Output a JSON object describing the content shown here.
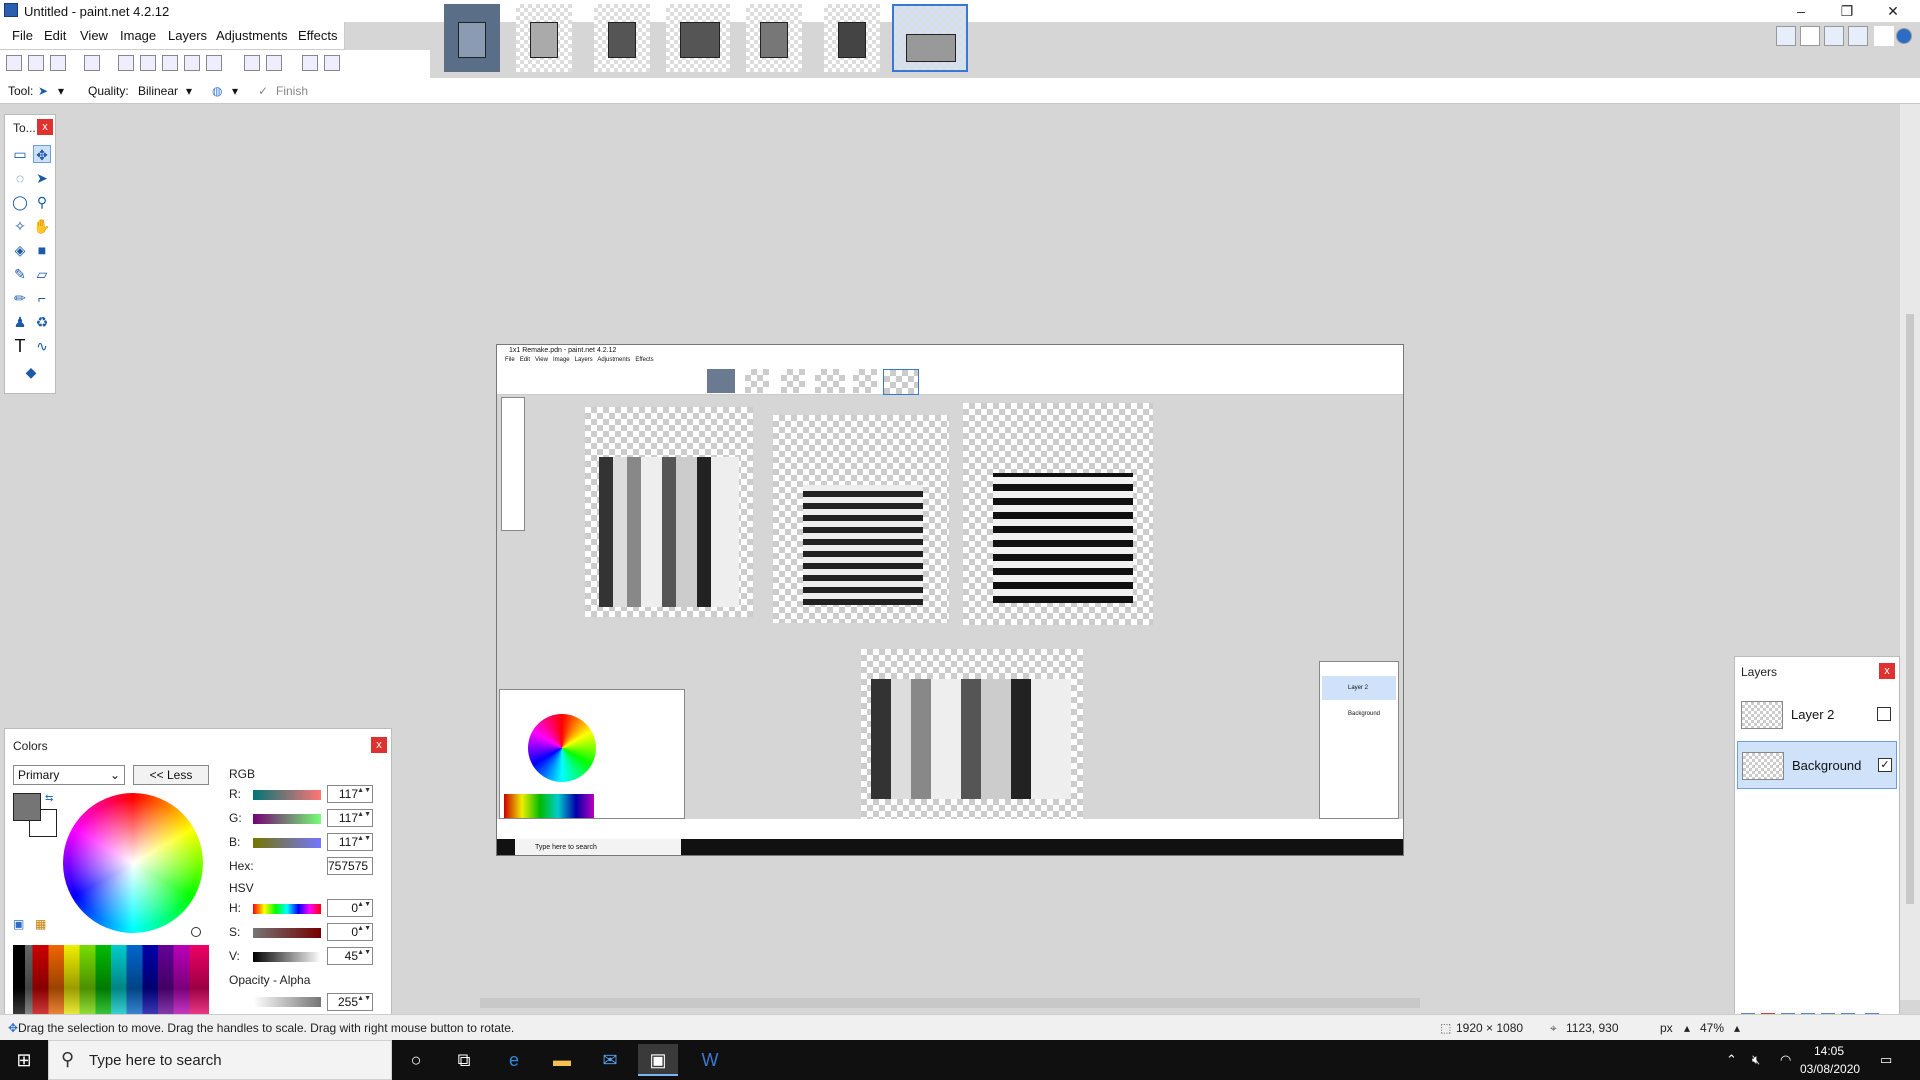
{
  "window": {
    "title": "Untitled - paint.net 4.2.12",
    "controls": [
      "–",
      "❐",
      "✕"
    ]
  },
  "menu": [
    "File",
    "Edit",
    "View",
    "Image",
    "Layers",
    "Adjustments",
    "Effects"
  ],
  "toolbar": {
    "tool_label": "Tool:",
    "quality_label": "Quality:",
    "quality_value": "Bilinear",
    "finish_label": "Finish",
    "finish_check": "✓",
    "dropdown_caret": "▾"
  },
  "tools_panel": {
    "title": "To...",
    "close": "x",
    "tools": [
      {
        "name": "rectangle-select",
        "glyph": "▭"
      },
      {
        "name": "move-selection",
        "glyph": "✥"
      },
      {
        "name": "lasso-select",
        "glyph": "◌"
      },
      {
        "name": "move-selected",
        "glyph": "➤"
      },
      {
        "name": "ellipse-select",
        "glyph": "◯"
      },
      {
        "name": "zoom",
        "glyph": "⚲"
      },
      {
        "name": "magic-wand",
        "glyph": "✧"
      },
      {
        "name": "pan",
        "glyph": "✋"
      },
      {
        "name": "paint-bucket",
        "glyph": "◈"
      },
      {
        "name": "gradient",
        "glyph": "■"
      },
      {
        "name": "paintbrush",
        "glyph": "✎"
      },
      {
        "name": "eraser",
        "glyph": "▱"
      },
      {
        "name": "pencil",
        "glyph": "✏"
      },
      {
        "name": "color-picker",
        "glyph": "⌐"
      },
      {
        "name": "clone-stamp",
        "glyph": "♟"
      },
      {
        "name": "recolor",
        "glyph": "♻"
      },
      {
        "name": "text",
        "glyph": "T"
      },
      {
        "name": "line-curve",
        "glyph": "∿"
      },
      {
        "name": "shapes",
        "glyph": "◆"
      }
    ]
  },
  "colors_panel": {
    "title": "Colors",
    "close": "x",
    "mode": "Primary",
    "less_button": "<< Less",
    "rgb_label": "RGB",
    "r_label": "R:",
    "r_value": "117",
    "g_label": "G:",
    "g_value": "117",
    "b_label": "B:",
    "b_value": "117",
    "hex_label": "Hex:",
    "hex_value": "757575",
    "hsv_label": "HSV",
    "h_label": "H:",
    "h_value": "0",
    "s_label": "S:",
    "s_value": "0",
    "v_label": "V:",
    "v_value": "45",
    "opacity_label": "Opacity - Alpha",
    "opacity_value": "255",
    "primary_color": "#757575",
    "spinner": "▲▼"
  },
  "layers_panel": {
    "title": "Layers",
    "close": "x",
    "layers": [
      {
        "name": "Layer 2",
        "visible": false,
        "check": ""
      },
      {
        "name": "Background",
        "visible": true,
        "check": "✓"
      }
    ]
  },
  "status": {
    "hint": "Drag the selection to move. Drag the handles to scale. Drag with right mouse button to rotate.",
    "image_size": "1920 × 1080",
    "cursor_pos": "1123, 930",
    "units": "px",
    "zoom": "47%"
  },
  "canvas": {
    "inner_title": "1x1 Remake.pdn - paint.net 4.2.12",
    "inner_menu": [
      "File",
      "Edit",
      "View",
      "Image",
      "Layers",
      "Adjustments",
      "Effects"
    ],
    "inner_layers": [
      "Layer 2",
      "Background"
    ],
    "inner_search": "Type here to search"
  },
  "taskbar": {
    "search_placeholder": "Type here to search",
    "time": "14:05",
    "date": "03/08/2020"
  }
}
